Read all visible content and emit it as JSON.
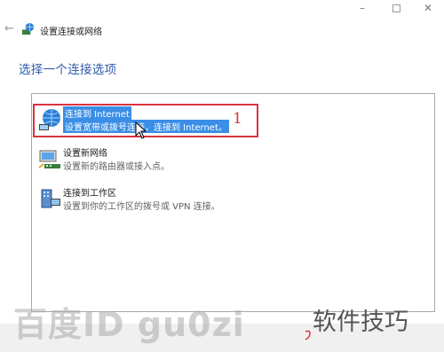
{
  "window": {
    "title": "设置连接或网络",
    "back_icon": "back-arrow-icon",
    "min_glyph": "–",
    "close_glyph": "✕"
  },
  "page": {
    "title": "选择一个连接选项"
  },
  "options": [
    {
      "title": "连接到 Internet",
      "description": "设置宽带或拨号连接，连接到 Internet。",
      "icon": "globe-network-icon",
      "selected": true
    },
    {
      "title": "设置新网络",
      "description": "设置新的路由器或接入点。",
      "icon": "router-setup-icon",
      "selected": false
    },
    {
      "title": "连接到工作区",
      "description": "设置到你的工作区的拨号或 VPN 连接。",
      "icon": "workplace-vpn-icon",
      "selected": false
    }
  ],
  "annotation": {
    "step_number": "1",
    "color": "#d8333f"
  },
  "watermark": {
    "text": "百度ID gu0zi",
    "brand": "软件技巧"
  },
  "colors": {
    "accent": "#2f5aa8",
    "selection": "#3a8ee6"
  }
}
